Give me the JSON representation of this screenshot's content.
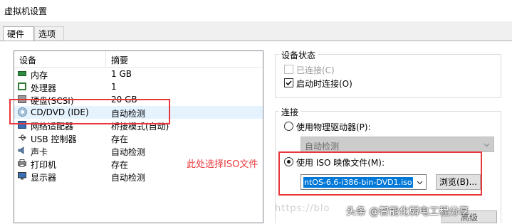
{
  "window": {
    "title": "虚拟机设置"
  },
  "tabs": [
    {
      "label": "硬件"
    },
    {
      "label": "选项"
    }
  ],
  "device_list": {
    "header": {
      "device": "设备",
      "summary": "摘要"
    },
    "rows": [
      {
        "name": "内存",
        "summary": "1 GB",
        "icon": "memory-icon"
      },
      {
        "name": "处理器",
        "summary": "1",
        "icon": "processor-icon"
      },
      {
        "name": "硬盘(SCSI)",
        "summary": "20 GB",
        "icon": "hard-disk-icon"
      },
      {
        "name": "CD/DVD (IDE)",
        "summary": "自动检测",
        "icon": "cd-dvd-icon"
      },
      {
        "name": "网络适配器",
        "summary": "桥接模式(自动)",
        "icon": "network-adapter-icon"
      },
      {
        "name": "USB 控制器",
        "summary": "存在",
        "icon": "usb-icon"
      },
      {
        "name": "声卡",
        "summary": "自动检测",
        "icon": "speaker-icon"
      },
      {
        "name": "打印机",
        "summary": "存在",
        "icon": "printer-icon"
      },
      {
        "name": "显示器",
        "summary": "自动检测",
        "icon": "monitor-icon"
      }
    ]
  },
  "device_status": {
    "title": "设备状态",
    "connected": {
      "label": "已连接(C)",
      "checked": false,
      "enabled": false
    },
    "connect_at_power_on": {
      "label": "启动时连接(O)",
      "checked": true
    }
  },
  "connection": {
    "title": "连接",
    "physical": {
      "label": "使用物理驱动器(P):",
      "selected": false,
      "dropdown_value": "自动检测"
    },
    "iso": {
      "label": "使用 ISO 映像文件(M):",
      "selected": true,
      "file_value": "ntOS-6.6-i386-bin-DVD1.iso",
      "browse_label": "浏览(B)..."
    },
    "advanced_label": "高级"
  },
  "annotation": {
    "text": "此处选择ISO文件"
  },
  "watermark": {
    "url": "https://blo",
    "credit": "头条 @智能化弱电工程分享"
  },
  "colors": {
    "highlight_red": "#e8383d",
    "selection_blue": "#0078d7"
  }
}
